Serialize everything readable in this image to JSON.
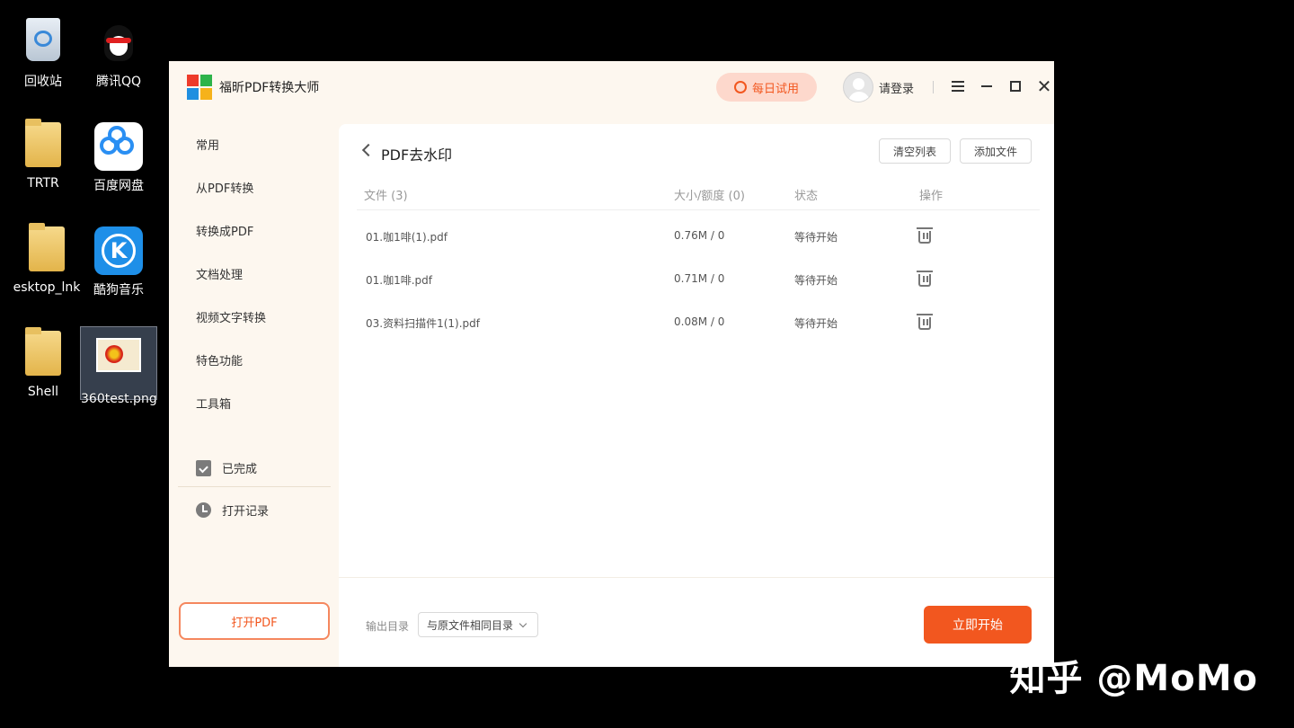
{
  "desktop": {
    "icons": [
      {
        "label": "回收站",
        "icon": "recycle-bin-icon"
      },
      {
        "label": "腾讯QQ",
        "icon": "qq-icon"
      },
      {
        "label": "TRTR",
        "icon": "folder-icon"
      },
      {
        "label": "百度网盘",
        "icon": "baidu-netdisk-icon"
      },
      {
        "label": "esktop_lnk",
        "icon": "folder-icon"
      },
      {
        "label": "酷狗音乐",
        "icon": "kugou-music-icon"
      },
      {
        "label": "Shell",
        "icon": "folder-icon"
      },
      {
        "label": "360test.png",
        "icon": "image-file-icon"
      }
    ],
    "watermark": "知乎 @MoMo"
  },
  "app": {
    "title": "福昕PDF转换大师",
    "trial_label": "每日试用",
    "login_label": "请登录",
    "accent": "#f2571f"
  },
  "sidebar": {
    "items": [
      "常用",
      "从PDF转换",
      "转换成PDF",
      "文档处理",
      "视频文字转换",
      "特色功能",
      "工具箱"
    ],
    "completed_label": "已完成",
    "history_label": "打开记录",
    "open_pdf_label": "打开PDF"
  },
  "panel": {
    "title": "PDF去水印",
    "clear_label": "清空列表",
    "add_label": "添加文件",
    "columns": {
      "file": "文件 (3)",
      "size": "大小/额度 (0)",
      "status": "状态",
      "action": "操作"
    },
    "rows": [
      {
        "name": "01.咖1啡(1).pdf",
        "size": "0.76M / 0",
        "status": "等待开始"
      },
      {
        "name": "01.咖1啡.pdf",
        "size": "0.71M / 0",
        "status": "等待开始"
      },
      {
        "name": "03.资料扫描件1(1).pdf",
        "size": "0.08M / 0",
        "status": "等待开始"
      }
    ],
    "output_label": "输出目录",
    "output_value": "与原文件相同目录",
    "start_label": "立即开始"
  }
}
